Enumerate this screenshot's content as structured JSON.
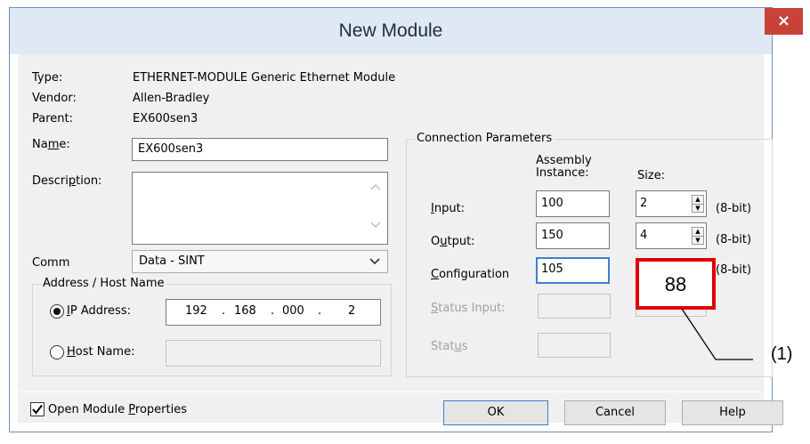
{
  "window": {
    "title": "New Module",
    "close_glyph": "×"
  },
  "info": [
    {
      "label": "Type:",
      "value": "ETHERNET-MODULE Generic Ethernet Module"
    },
    {
      "label": "Vendor:",
      "value": "Allen-Bradley"
    },
    {
      "label": "Parent:",
      "value": "EX600sen3"
    }
  ],
  "name": {
    "label_pre": "Na",
    "label_u": "m",
    "label_post": "e:",
    "value": "EX600sen3"
  },
  "description": {
    "label_pre": "Descri",
    "label_u": "p",
    "label_post": "tion:",
    "value": ""
  },
  "comm": {
    "label": "Comm",
    "selected": "Data - SINT"
  },
  "address": {
    "group_title": "Address / Host Name",
    "ip_label_u": "I",
    "ip_label_post": "P Address:",
    "ip_octets": [
      "192",
      "168",
      "000",
      "2"
    ],
    "ip_sep": ".",
    "host_label_u": "H",
    "host_label_post": "ost Name:",
    "host_value": ""
  },
  "connection": {
    "group_title": "Connection Parameters",
    "col_instance": "Assembly\nInstance:",
    "col_instance_l1": "Assembly",
    "col_instance_l2": "Instance:",
    "col_size": "Size:",
    "rows": [
      {
        "label_u": "I",
        "label_post": "nput:",
        "instance": "100",
        "size": "2",
        "unit": "(8-bit)"
      },
      {
        "label_pre": "O",
        "label_u": "u",
        "label_post": "tput:",
        "instance": "150",
        "size": "4",
        "unit": "(8-bit)"
      },
      {
        "label_u": "C",
        "label_post": "onfiguration",
        "instance": "105",
        "size": "88",
        "unit": "(8-bit)"
      },
      {
        "label_pre": "",
        "label_u": "S",
        "label_post": "tatus Input:",
        "instance": "",
        "size": ""
      },
      {
        "label_pre": "Stat",
        "label_u": "u",
        "label_post": "s",
        "instance": ""
      }
    ]
  },
  "annotation": {
    "callout": "(1)",
    "highlight_value": "88",
    "highlight_color": "#e00000"
  },
  "footer": {
    "checkbox_label_pre": "Open Module ",
    "checkbox_label_u": "P",
    "checkbox_label_post": "roperties",
    "checked": true,
    "buttons": [
      "OK",
      "Cancel",
      "Help"
    ]
  }
}
